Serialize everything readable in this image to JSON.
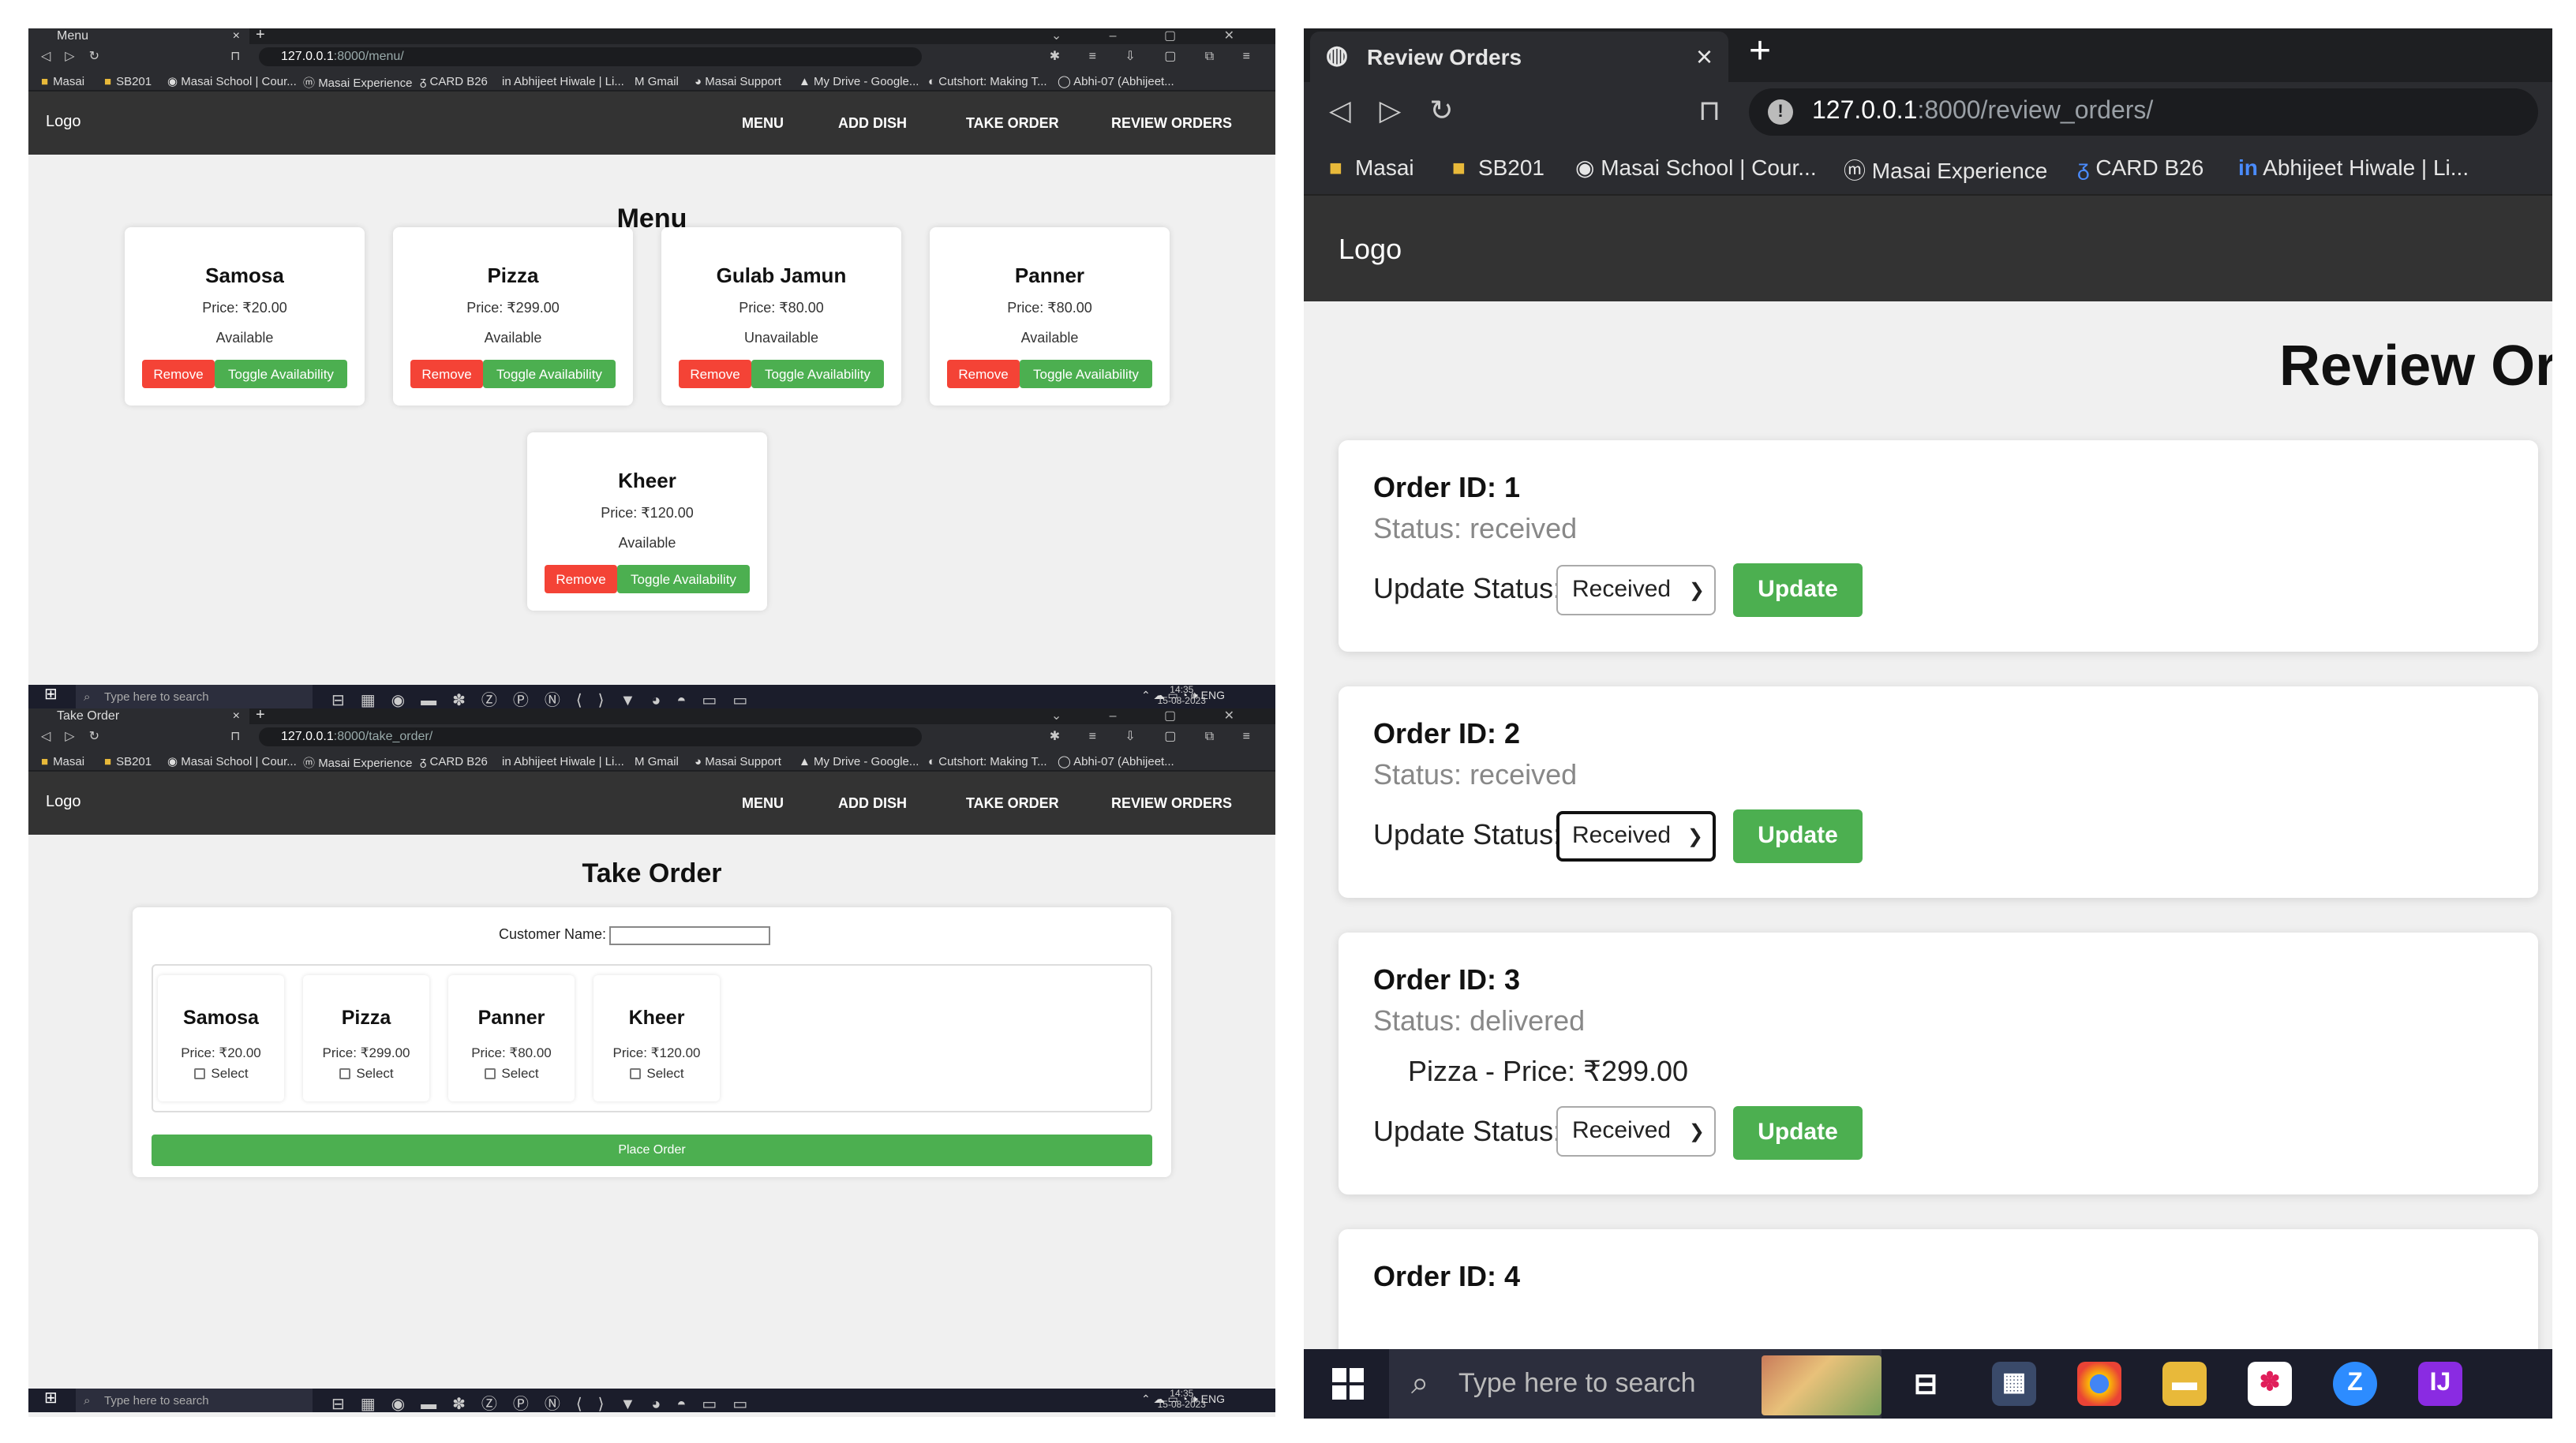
{
  "nav": {
    "logo": "Logo",
    "links": [
      "MENU",
      "ADD DISH",
      "TAKE ORDER",
      "REVIEW ORDERS"
    ]
  },
  "bookmarks_small": [
    "Masai",
    "SB201",
    "Masai School | Cour...",
    "Masai Experience",
    "CARD B26",
    "Abhijeet Hiwale | Li...",
    "Gmail",
    "Masai Support",
    "My Drive - Google...",
    "Cutshort: Making T...",
    "Abhi-07 (Abhijeet..."
  ],
  "bookmarks_big": [
    "Masai",
    "SB201",
    "Masai School | Cour...",
    "Masai Experience",
    "CARD B26",
    "Abhijeet Hiwale | Li..."
  ],
  "taskbar": {
    "search_placeholder": "Type here to search",
    "time": "14:35",
    "date": "15-08-2023",
    "lang": "ENG"
  },
  "menu_window": {
    "tab_title": "Menu",
    "url_host": "127.0.0.1",
    "url_path": ":8000/menu/",
    "page_title": "Menu",
    "remove_label": "Remove",
    "toggle_label": "Toggle Availability",
    "dishes": [
      {
        "name": "Samosa",
        "price": "Price: ₹20.00",
        "status": "Available"
      },
      {
        "name": "Pizza",
        "price": "Price: ₹299.00",
        "status": "Available"
      },
      {
        "name": "Gulab Jamun",
        "price": "Price: ₹80.00",
        "status": "Unavailable"
      },
      {
        "name": "Panner",
        "price": "Price: ₹80.00",
        "status": "Available"
      },
      {
        "name": "Kheer",
        "price": "Price: ₹120.00",
        "status": "Available"
      }
    ]
  },
  "take_order_window": {
    "tab_title": "Take Order",
    "url_host": "127.0.0.1",
    "url_path": ":8000/take_order/",
    "page_title": "Take Order",
    "customer_label": "Customer Name:",
    "customer_value": "",
    "select_label": "Select",
    "place_order_label": "Place Order",
    "items": [
      {
        "name": "Samosa",
        "price": "Price: ₹20.00"
      },
      {
        "name": "Pizza",
        "price": "Price: ₹299.00"
      },
      {
        "name": "Panner",
        "price": "Price: ₹80.00"
      },
      {
        "name": "Kheer",
        "price": "Price: ₹120.00"
      }
    ]
  },
  "review_window": {
    "tab_title": "Review Orders",
    "url_host": "127.0.0.1",
    "url_path": ":8000/review_orders/",
    "page_title": "Review Orders",
    "update_status_label": "Update Status:",
    "update_button": "Update",
    "orders": [
      {
        "id": "Order ID: 1",
        "status": "Status: received",
        "item": "",
        "selected": "Received"
      },
      {
        "id": "Order ID: 2",
        "status": "Status: received",
        "item": "",
        "selected": "Received"
      },
      {
        "id": "Order ID: 3",
        "status": "Status: delivered",
        "item": "Pizza - Price: ₹299.00",
        "selected": "Received"
      },
      {
        "id": "Order ID: 4",
        "status": "",
        "item": "",
        "selected": ""
      }
    ]
  },
  "colors": {
    "nav_bg": "#333333",
    "remove": "#f44336",
    "accent_green": "#4caf50",
    "page_bg": "#f0f0f0"
  }
}
